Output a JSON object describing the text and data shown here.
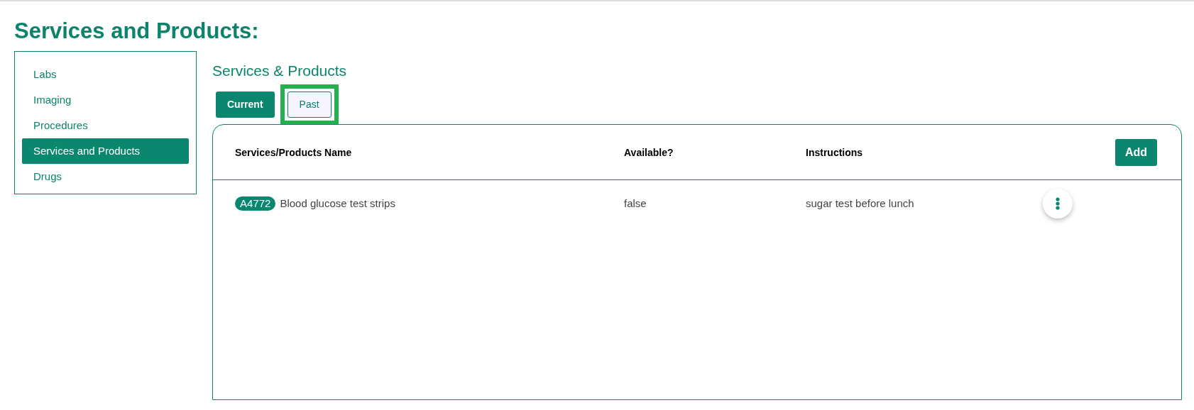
{
  "page_title": "Services and Products:",
  "sidebar": {
    "items": [
      {
        "label": "Labs",
        "selected": false
      },
      {
        "label": "Imaging",
        "selected": false
      },
      {
        "label": "Procedures",
        "selected": false
      },
      {
        "label": "Services and Products",
        "selected": true
      },
      {
        "label": "Drugs",
        "selected": false
      }
    ]
  },
  "section_title": "Services & Products",
  "tabs": [
    {
      "label": "Current",
      "selected": true,
      "highlighted": false
    },
    {
      "label": "Past",
      "selected": false,
      "highlighted": true
    }
  ],
  "table": {
    "columns": [
      "Services/Products Name",
      "Available?",
      "Instructions"
    ],
    "add_button": "Add",
    "rows": [
      {
        "code": "A4772",
        "name": "Blood glucose test strips",
        "available": "false",
        "instructions": "sugar test before lunch"
      }
    ]
  }
}
